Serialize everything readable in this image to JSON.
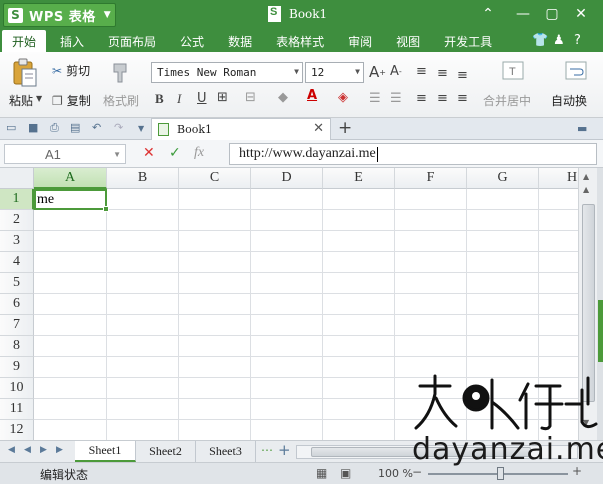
{
  "app": {
    "logo_letter": "S",
    "name": "WPS 表格",
    "dropdown_glyph": "▼",
    "document_title": "Book1"
  },
  "window_controls": {
    "collapse": "⌃",
    "minimize": "—",
    "maximize": "▢",
    "close": "✕"
  },
  "menu": {
    "tabs": [
      "开始",
      "插入",
      "页面布局",
      "公式",
      "数据",
      "表格样式",
      "审阅",
      "视图",
      "开发工具"
    ],
    "active_tab": "开始",
    "right_tools": [
      "shirt-icon",
      "user-icon",
      "help-icon"
    ]
  },
  "ribbon": {
    "paste_label": "粘贴",
    "cut_label": "剪切",
    "copy_label": "复制",
    "format_painter_label": "格式刷",
    "font_name": "Times New Roman",
    "font_size": "12",
    "merge_center_label": "合并居中",
    "wrap_label": "自动换"
  },
  "doc_tab": {
    "label": "Book1",
    "close": "✕",
    "new_tab": "+"
  },
  "formula_bar": {
    "cell_ref": "A1",
    "cancel": "✕",
    "confirm": "✓",
    "fx": "fx",
    "content": "http://www.dayanzai.me"
  },
  "grid": {
    "columns": [
      "A",
      "B",
      "C",
      "D",
      "E",
      "F",
      "G",
      "H"
    ],
    "rows": [
      "1",
      "2",
      "3",
      "4",
      "5",
      "6",
      "7",
      "8",
      "9",
      "10",
      "11",
      "12"
    ],
    "selected_column": "A",
    "selected_row": "1",
    "cell_A1": "me"
  },
  "sheets": {
    "tabs": [
      "Sheet1",
      "Sheet2",
      "Sheet3"
    ],
    "active": "Sheet1",
    "add": "+"
  },
  "status": {
    "mode": "编辑状态",
    "zoom": "100 %",
    "zoom_level": 0.5
  },
  "watermark": {
    "brand_text": "dayanzai.me",
    "logo_lettering": "大眼仔-旭"
  },
  "colors": {
    "accent": "#3e8e3e",
    "selection": "#4c9a3a"
  }
}
